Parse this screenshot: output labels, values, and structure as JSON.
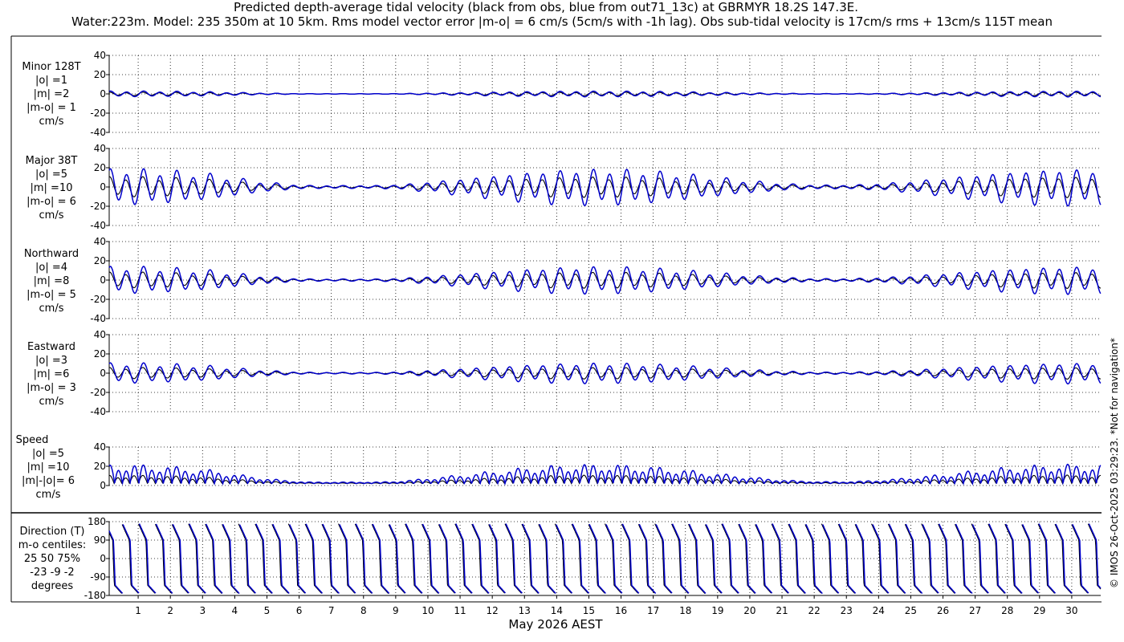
{
  "title_line1": "Predicted depth-average tidal velocity (black from obs, blue from out71_13c) at GBRMYR 18.2S 147.3E.",
  "title_line2": "Water:223m. Model: 235 350m at 10 5km. Rms model vector error |m-o| = 6 cm/s (5cm/s with -1h lag). Obs sub-tidal velocity is 17cm/s rms + 13cm/s 115T mean",
  "copyright": "© IMOS 26-Oct-2025 03:29:23. *Not for navigation*",
  "colors": {
    "obs": "#000000",
    "model": "#0000cc",
    "grid": "#000000"
  },
  "chart_data": {
    "type": "line",
    "xlabel": "May 2026 AEST",
    "x_ticks": [
      "1",
      "2",
      "3",
      "4",
      "5",
      "6",
      "7",
      "8",
      "9",
      "10",
      "11",
      "12",
      "13",
      "14",
      "15",
      "16",
      "17",
      "18",
      "19",
      "20",
      "21",
      "22",
      "23",
      "24",
      "25",
      "26",
      "27",
      "28",
      "29",
      "30"
    ],
    "xlim_days": [
      0.1,
      30.9
    ],
    "series_names": [
      "obs (black)",
      "model (blue)"
    ],
    "panels": [
      {
        "id": "minor",
        "label_lines": [
          "Minor 128T",
          "|o| =1",
          "|m| =2",
          "|m-o| = 1",
          "cm/s"
        ],
        "ylim": [
          -40,
          40
        ],
        "y_ticks": [
          -40,
          -20,
          0,
          20,
          40
        ],
        "y_tick_labels": [
          "-40",
          "-20",
          "0",
          "20",
          "40"
        ],
        "obs_amplitude": 1.5,
        "model_amplitude": 2.5
      },
      {
        "id": "major",
        "label_lines": [
          "Major 38T",
          "|o| =5",
          "|m| =10",
          "|m-o| = 6",
          "cm/s"
        ],
        "ylim": [
          -40,
          40
        ],
        "y_ticks": [
          -40,
          -20,
          0,
          20,
          40
        ],
        "y_tick_labels": [
          "-40",
          "-20",
          "0",
          "20",
          "40"
        ],
        "obs_amplitude": 9,
        "model_amplitude": 16
      },
      {
        "id": "north",
        "label_lines": [
          "Northward",
          "|o| =4",
          "|m| =8",
          "|m-o| = 5",
          "cm/s"
        ],
        "ylim": [
          -40,
          40
        ],
        "y_ticks": [
          -40,
          -20,
          0,
          20,
          40
        ],
        "y_tick_labels": [
          "-40",
          "-20",
          "0",
          "20",
          "40"
        ],
        "obs_amplitude": 7,
        "model_amplitude": 12
      },
      {
        "id": "east",
        "label_lines": [
          "Eastward",
          "|o| =3",
          "|m| =6",
          "|m-o| = 3",
          "cm/s"
        ],
        "ylim": [
          -40,
          40
        ],
        "y_ticks": [
          -40,
          -20,
          0,
          20,
          40
        ],
        "y_tick_labels": [
          "-40",
          "-20",
          "0",
          "20",
          "40"
        ],
        "obs_amplitude": 5,
        "model_amplitude": 9
      },
      {
        "id": "speed",
        "label_lines": [
          "Speed",
          "|o| =5",
          "|m| =10",
          "|m|-|o|= 6",
          "cm/s"
        ],
        "ylim": [
          0,
          40
        ],
        "y_ticks": [
          0,
          20,
          40
        ],
        "y_tick_labels": [
          "0",
          "20",
          "40"
        ],
        "obs_amplitude": 8,
        "model_amplitude": 18
      },
      {
        "id": "direction",
        "label_lines": [
          "Direction (T)",
          "m-o centiles:",
          "25  50  75%",
          "-23  -9  -2",
          "degrees"
        ],
        "ylim": [
          -180,
          180
        ],
        "y_ticks": [
          -180,
          -90,
          0,
          90,
          180
        ],
        "y_tick_labels": [
          "-180",
          "-90",
          "0",
          "90",
          "180"
        ]
      }
    ]
  }
}
